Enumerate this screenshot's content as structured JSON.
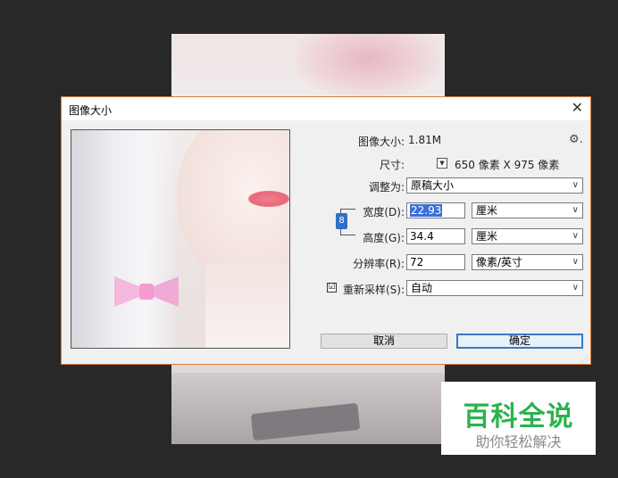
{
  "dialog": {
    "title": "图像大小",
    "close_glyph": "✕",
    "image_size_label": "图像大小:",
    "image_size_value": "1.81M",
    "dimensions_label": "尺寸:",
    "dimensions_value": "650 像素  X  975 像素",
    "fit_to_label": "调整为:",
    "fit_to_value": "原稿大小",
    "width_label": "宽度(D):",
    "width_value": "22.93",
    "width_unit": "厘米",
    "height_label": "高度(G):",
    "height_value": "34.4",
    "height_unit": "厘米",
    "resolution_label": "分辨率(R):",
    "resolution_value": "72",
    "resolution_unit": "像素/英寸",
    "resample_label": "重新采样(S):",
    "resample_checked": "☑",
    "resample_value": "自动",
    "cancel_label": "取消",
    "ok_label": "确定"
  },
  "icons": {
    "gear": "⚙.",
    "dropdown": "∨",
    "mini_dropdown": "▼",
    "link": "8"
  },
  "watermark": {
    "title": "百科全说",
    "subtitle": "助你轻松解决"
  },
  "colors": {
    "dialog_border": "#e07b3a",
    "accent_blue": "#3a78c8",
    "watermark_green": "#2bb24c"
  }
}
